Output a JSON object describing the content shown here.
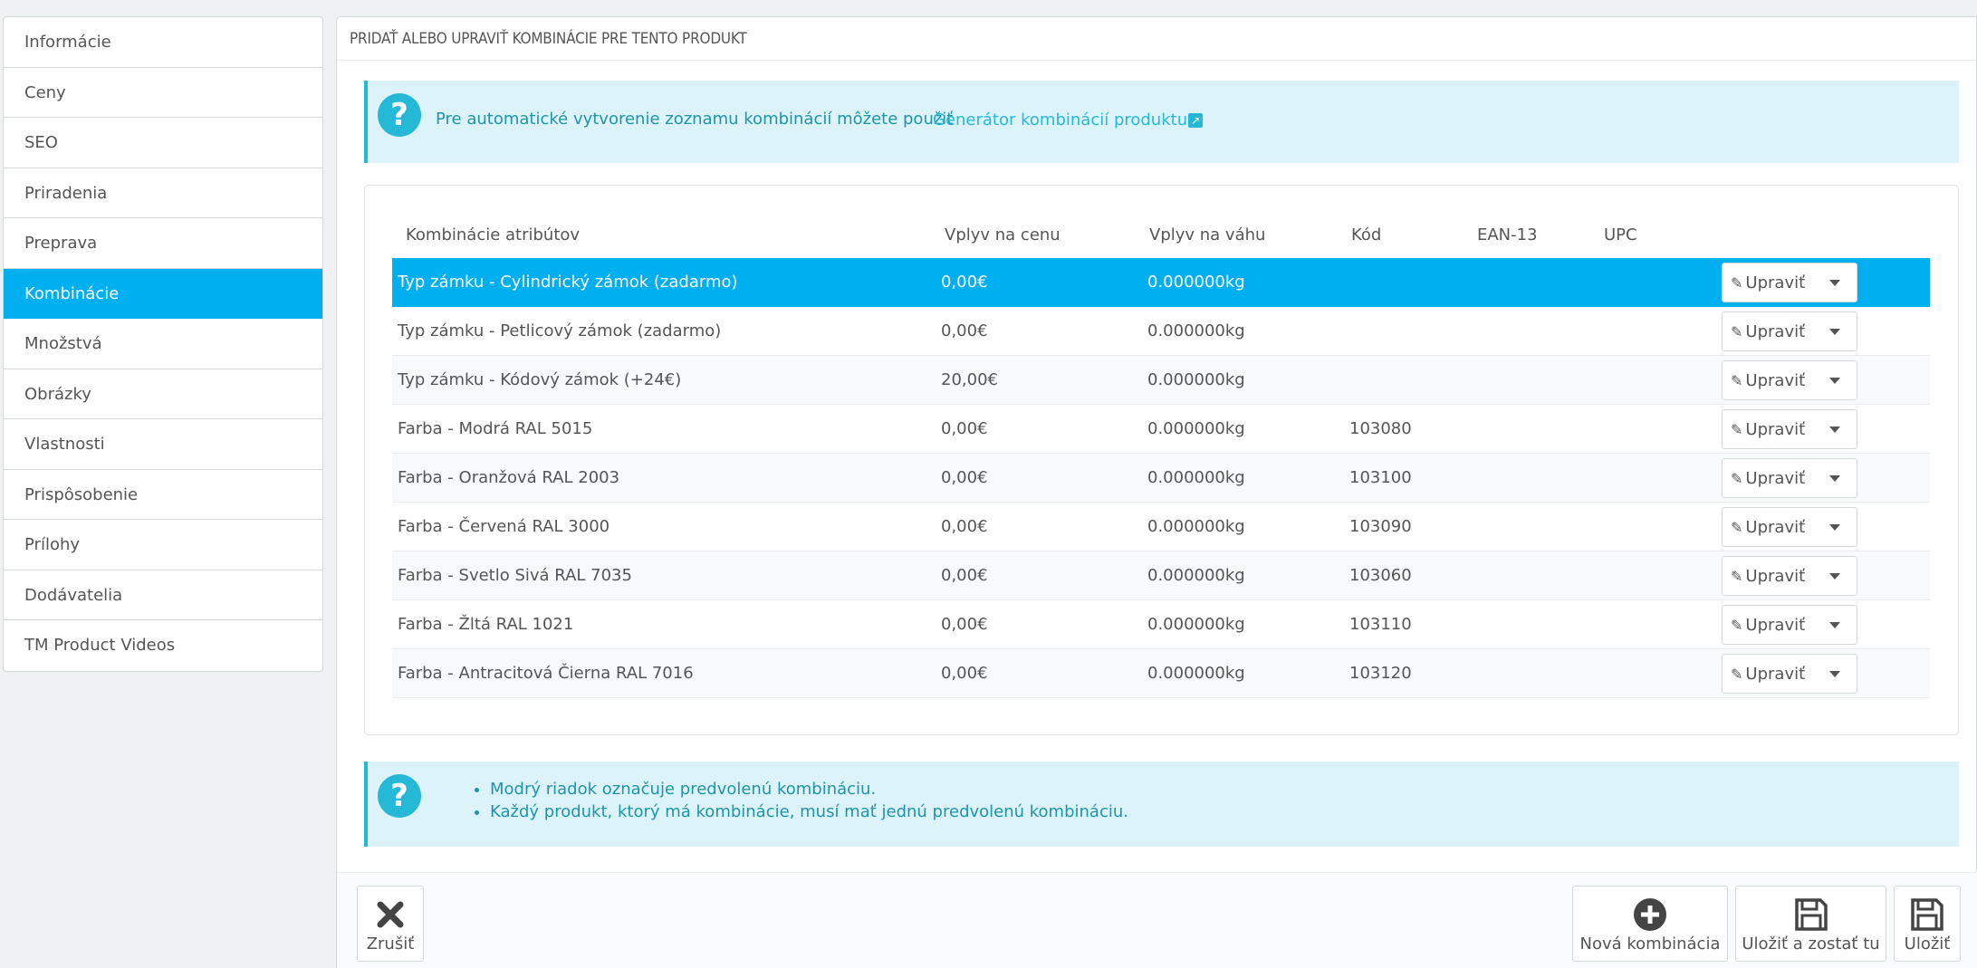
{
  "sidebar": {
    "items": [
      {
        "label": "Informácie"
      },
      {
        "label": "Ceny"
      },
      {
        "label": "SEO"
      },
      {
        "label": "Priradenia"
      },
      {
        "label": "Preprava"
      },
      {
        "label": "Kombinácie"
      },
      {
        "label": "Množstvá"
      },
      {
        "label": "Obrázky"
      },
      {
        "label": "Vlastnosti"
      },
      {
        "label": "Prispôsobenie"
      },
      {
        "label": "Prílohy"
      },
      {
        "label": "Dodávatelia"
      },
      {
        "label": "TM Product Videos"
      }
    ],
    "active_index": 5
  },
  "panel": {
    "heading": "PRIDAŤ ALEBO UPRAVIŤ KOMBINÁCIE PRE TENTO PRODUKT"
  },
  "info_alert": {
    "text": "Pre automatické vytvorenie zoznamu kombinácií môžete použiť",
    "link": "Generátor kombinácií produktu"
  },
  "table": {
    "headers": {
      "attributes": "Kombinácie atribútov",
      "price": "Vplyv na cenu",
      "weight": "Vplyv na váhu",
      "code": "Kód",
      "ean": "EAN-13",
      "upc": "UPC"
    },
    "edit_label": "Upraviť",
    "rows": [
      {
        "name": "Typ zámku - Cylindrický zámok (zadarmo)",
        "price": "0,00€",
        "weight": "0.000000kg",
        "code": "",
        "ean": "",
        "upc": ""
      },
      {
        "name": "Typ zámku - Petlicový zámok (zadarmo)",
        "price": "0,00€",
        "weight": "0.000000kg",
        "code": "",
        "ean": "",
        "upc": ""
      },
      {
        "name": "Typ zámku - Kódový zámok (+24€)",
        "price": "20,00€",
        "weight": "0.000000kg",
        "code": "",
        "ean": "",
        "upc": ""
      },
      {
        "name": "Farba - Modrá RAL 5015",
        "price": "0,00€",
        "weight": "0.000000kg",
        "code": "103080",
        "ean": "",
        "upc": ""
      },
      {
        "name": "Farba - Oranžová RAL 2003",
        "price": "0,00€",
        "weight": "0.000000kg",
        "code": "103100",
        "ean": "",
        "upc": ""
      },
      {
        "name": "Farba - Červená RAL 3000",
        "price": "0,00€",
        "weight": "0.000000kg",
        "code": "103090",
        "ean": "",
        "upc": ""
      },
      {
        "name": "Farba - Svetlo Sivá RAL 7035",
        "price": "0,00€",
        "weight": "0.000000kg",
        "code": "103060",
        "ean": "",
        "upc": ""
      },
      {
        "name": "Farba - Žltá RAL 1021",
        "price": "0,00€",
        "weight": "0.000000kg",
        "code": "103110",
        "ean": "",
        "upc": ""
      },
      {
        "name": "Farba - Antracitová Čierna RAL 7016",
        "price": "0,00€",
        "weight": "0.000000kg",
        "code": "103120",
        "ean": "",
        "upc": ""
      }
    ],
    "selected_index": 0
  },
  "notes_alert": {
    "items": [
      "Modrý riadok označuje predvolenú kombináciu.",
      "Každý produkt, ktorý má kombinácie, musí mať jednú predvolenú kombináciu."
    ]
  },
  "footer": {
    "cancel": "Zrušiť",
    "new_combination": "Nová kombinácia",
    "save_and_stay": "Uložiť a zostať tu",
    "save": "Uložiť"
  },
  "icons": {
    "help": "question-circle-icon",
    "external": "external-link-icon",
    "edit": "pencil-icon",
    "dropdown": "caret-down-icon",
    "cancel": "close-icon",
    "add": "plus-circle-icon",
    "save": "floppy-disk-icon"
  },
  "colors": {
    "accent": "#00aff0",
    "alert_bg": "#dcf4f9",
    "alert_text": "#1e94ab",
    "alert_border": "#25b9d7"
  }
}
